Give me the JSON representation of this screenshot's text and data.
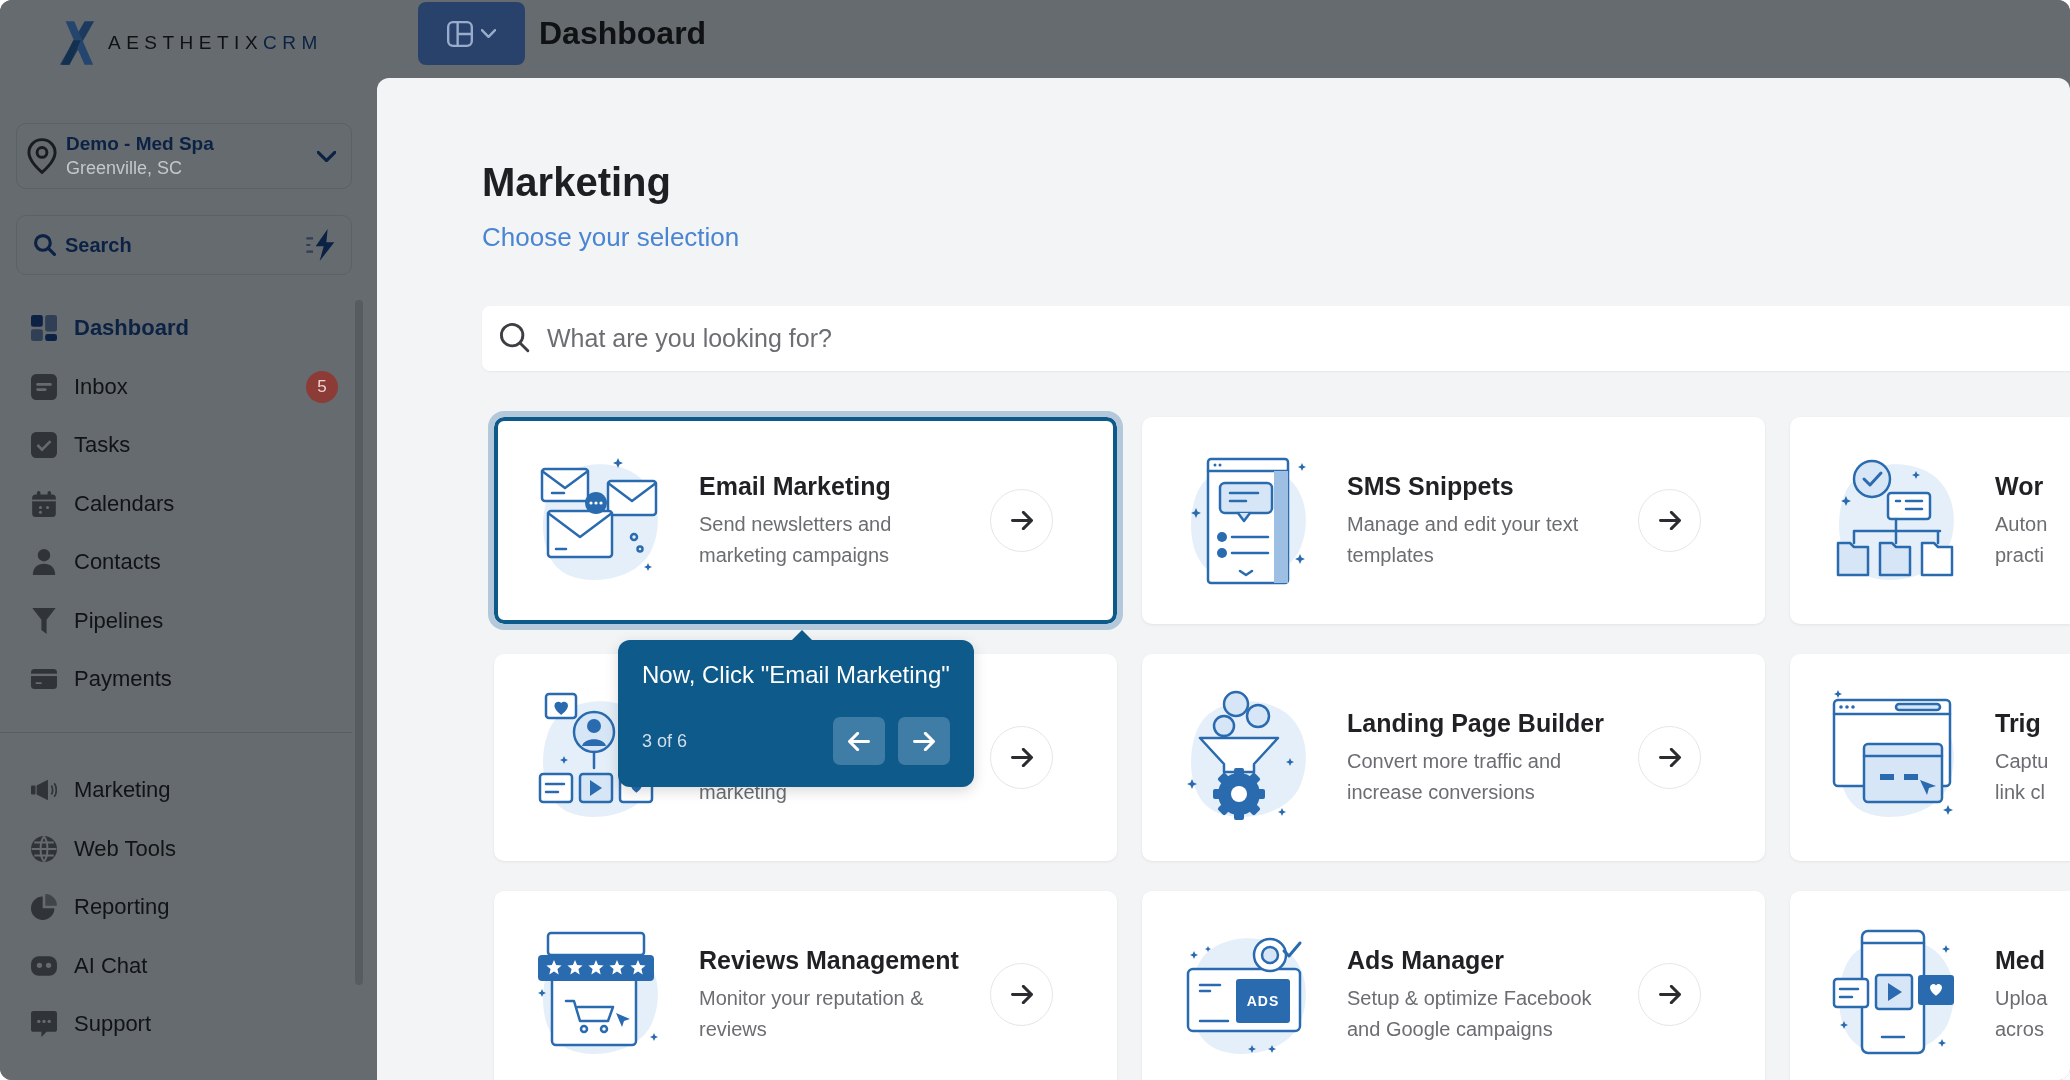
{
  "sidebar": {
    "logo": {
      "text": "AESTHETIX",
      "accent": "CRM"
    },
    "location": {
      "name": "Demo - Med Spa",
      "address": "Greenville, SC"
    },
    "search": {
      "label": "Search"
    },
    "sections": [
      {
        "items": [
          {
            "label": "Dashboard",
            "kind": "dashboard",
            "selected": true
          },
          {
            "label": "Inbox",
            "kind": "inbox",
            "selected": false,
            "badge": "5"
          },
          {
            "label": "Tasks",
            "kind": "tasks",
            "selected": false
          },
          {
            "label": "Calendars",
            "kind": "calendars",
            "selected": false
          },
          {
            "label": "Contacts",
            "kind": "contacts",
            "selected": false
          },
          {
            "label": "Pipelines",
            "kind": "pipelines",
            "selected": false
          },
          {
            "label": "Payments",
            "kind": "payments",
            "selected": false
          }
        ]
      },
      {
        "items": [
          {
            "label": "Marketing",
            "kind": "marketing",
            "selected": false
          },
          {
            "label": "Web Tools",
            "kind": "webtools",
            "selected": false
          },
          {
            "label": "Reporting",
            "kind": "reporting",
            "selected": false
          },
          {
            "label": "AI Chat",
            "kind": "aichat",
            "selected": false
          },
          {
            "label": "Support",
            "kind": "support",
            "selected": false
          }
        ]
      }
    ]
  },
  "header": {
    "title": "Dashboard"
  },
  "main": {
    "title": "Marketing",
    "subtitle": "Choose your selection",
    "search": {
      "placeholder": "What are you looking for?"
    },
    "cards": [
      {
        "title": "Email Marketing",
        "description": "Send newsletters and marketing campaigns",
        "kind": "envelopes",
        "highlighted": true,
        "open_button": true
      },
      {
        "title": "SMS Snippets",
        "description": "Manage and edit your text templates",
        "kind": "chat",
        "highlighted": false,
        "open_button": true
      },
      {
        "title": "Wor",
        "description": "Auton practi",
        "kind": "orgchart",
        "highlighted": false,
        "open_button": false
      },
      {
        "description": "marketing",
        "kind": "social",
        "highlighted": false,
        "open_button": true
      },
      {
        "title": "Landing Page Builder",
        "description": "Convert more traffic and increase conversions",
        "kind": "funnel",
        "highlighted": false,
        "open_button": true
      },
      {
        "title": "Trig",
        "description": "Captu link cl",
        "kind": "browser",
        "highlighted": false,
        "open_button": false
      },
      {
        "title": "Reviews Management",
        "description": "Monitor your reputation & reviews",
        "kind": "reviews",
        "highlighted": false,
        "open_button": true
      },
      {
        "title": "Ads Manager",
        "description": "Setup & optimize Facebook and Google campaigns",
        "kind": "ads",
        "illustration_text": "ADS",
        "highlighted": false,
        "open_button": true
      },
      {
        "title": "Med",
        "description": "Uploa acros",
        "kind": "video",
        "highlighted": false,
        "open_button": false
      }
    ]
  },
  "tour": {
    "message": "Now, Click \"Email Marketing\"",
    "step": "3 of 6"
  }
}
